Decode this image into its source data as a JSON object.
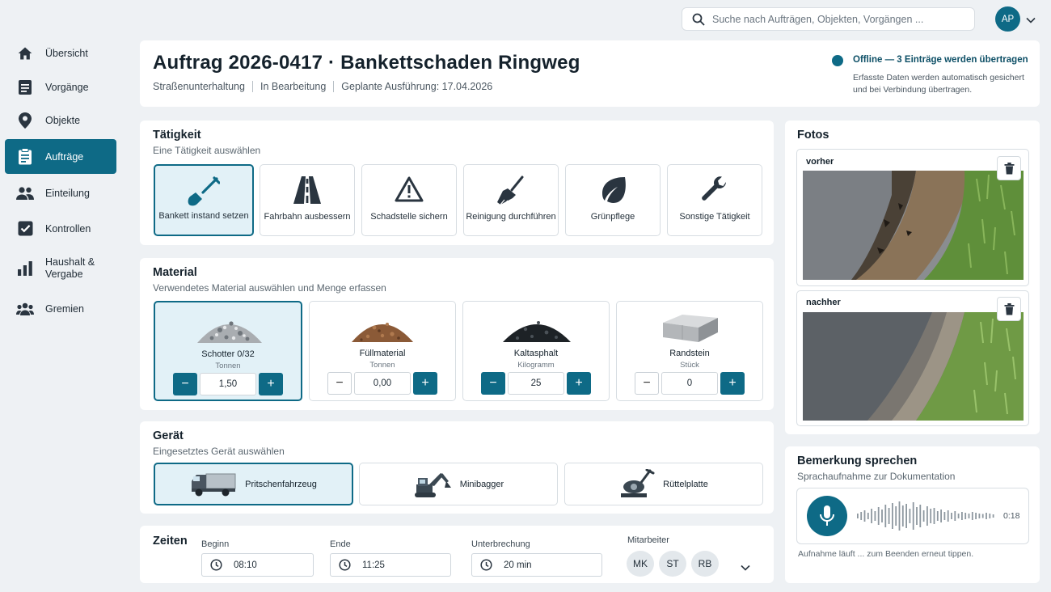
{
  "nav": {
    "items": [
      {
        "label": "Übersicht",
        "icon": "home-icon"
      },
      {
        "label": "Vorgänge",
        "icon": "document-icon"
      },
      {
        "label": "Objekte",
        "icon": "map-pin-icon"
      },
      {
        "label": "Aufträge",
        "icon": "clipboard-icon",
        "active": true
      },
      {
        "label": "Einteilung",
        "icon": "people-icon"
      },
      {
        "label": "Kontrollen",
        "icon": "checkbox-icon"
      },
      {
        "label": "Haushalt &",
        "label2": "Vergabe",
        "icon": "bar-chart-icon"
      },
      {
        "label": "Gremien",
        "icon": "group-icon"
      }
    ]
  },
  "search": {
    "placeholder": "Suche nach Aufträgen, Objekten, Vorgängen ..."
  },
  "user": {
    "initials": "AP"
  },
  "header": {
    "title": "Auftrag 2026-0417 · Bankettschaden Ringweg",
    "meta": [
      "Straßenunterhaltung",
      "In Bearbeitung",
      "Geplante Ausführung: 17.04.2026"
    ],
    "status_title": "Offline — 3 Einträge werden übertragen",
    "status_line1": "Erfasste Daten werden automatisch gesichert",
    "status_line2": "und bei Verbindung übertragen.",
    "status_color": "#0e6a86"
  },
  "taetigkeit": {
    "title": "Tätigkeit",
    "subtitle": "Eine Tätigkeit auswählen",
    "options": [
      {
        "label": "Bankett instand setzen",
        "icon": "shovel-icon",
        "selected": true
      },
      {
        "label": "Fahrbahn ausbessern",
        "icon": "road-icon"
      },
      {
        "label": "Schadstelle sichern",
        "icon": "warning-icon"
      },
      {
        "label": "Reinigung durchführen",
        "icon": "broom-icon"
      },
      {
        "label": "Grünpflege",
        "icon": "leaf-icon"
      },
      {
        "label": "Sonstige Tätigkeit",
        "icon": "wrench-icon"
      }
    ]
  },
  "material": {
    "title": "Material",
    "subtitle": "Verwendetes Material auswählen und Menge erfassen",
    "items": [
      {
        "name": "Schotter 0/32",
        "unit": "Tonnen",
        "value": "1,50",
        "selected": true
      },
      {
        "name": "Füllmaterial",
        "unit": "Tonnen",
        "value": "0,00"
      },
      {
        "name": "Kaltasphalt",
        "unit": "Kilogramm",
        "value": "25"
      },
      {
        "name": "Randstein",
        "unit": "Stück",
        "value": "0"
      }
    ]
  },
  "geraet": {
    "title": "Gerät",
    "subtitle": "Eingesetztes Gerät auswählen",
    "options": [
      {
        "label": "Pritschenfahrzeug",
        "icon": "truck-icon",
        "selected": true
      },
      {
        "label": "Minibagger",
        "icon": "excavator-icon"
      },
      {
        "label": "Rüttelplatte",
        "icon": "compactor-icon"
      }
    ]
  },
  "zeiten": {
    "title": "Zeiten",
    "begin_label": "Beginn",
    "begin": "08:10",
    "end_label": "Ende",
    "end": "11:25",
    "pause_label": "Unterbrechung",
    "pause": "20 min",
    "staff_label": "Mitarbeiter",
    "staff": [
      "MK",
      "ST",
      "RB"
    ]
  },
  "fotos": {
    "title": "Fotos",
    "items": [
      {
        "label": "vorher"
      },
      {
        "label": "nachher"
      }
    ]
  },
  "voice": {
    "title": "Bemerkung sprechen",
    "subtitle": "Sprachaufnahme zur Dokumentation",
    "time": "0:18",
    "hint": "Aufnahme läuft ... zum Beenden erneut tippen."
  }
}
